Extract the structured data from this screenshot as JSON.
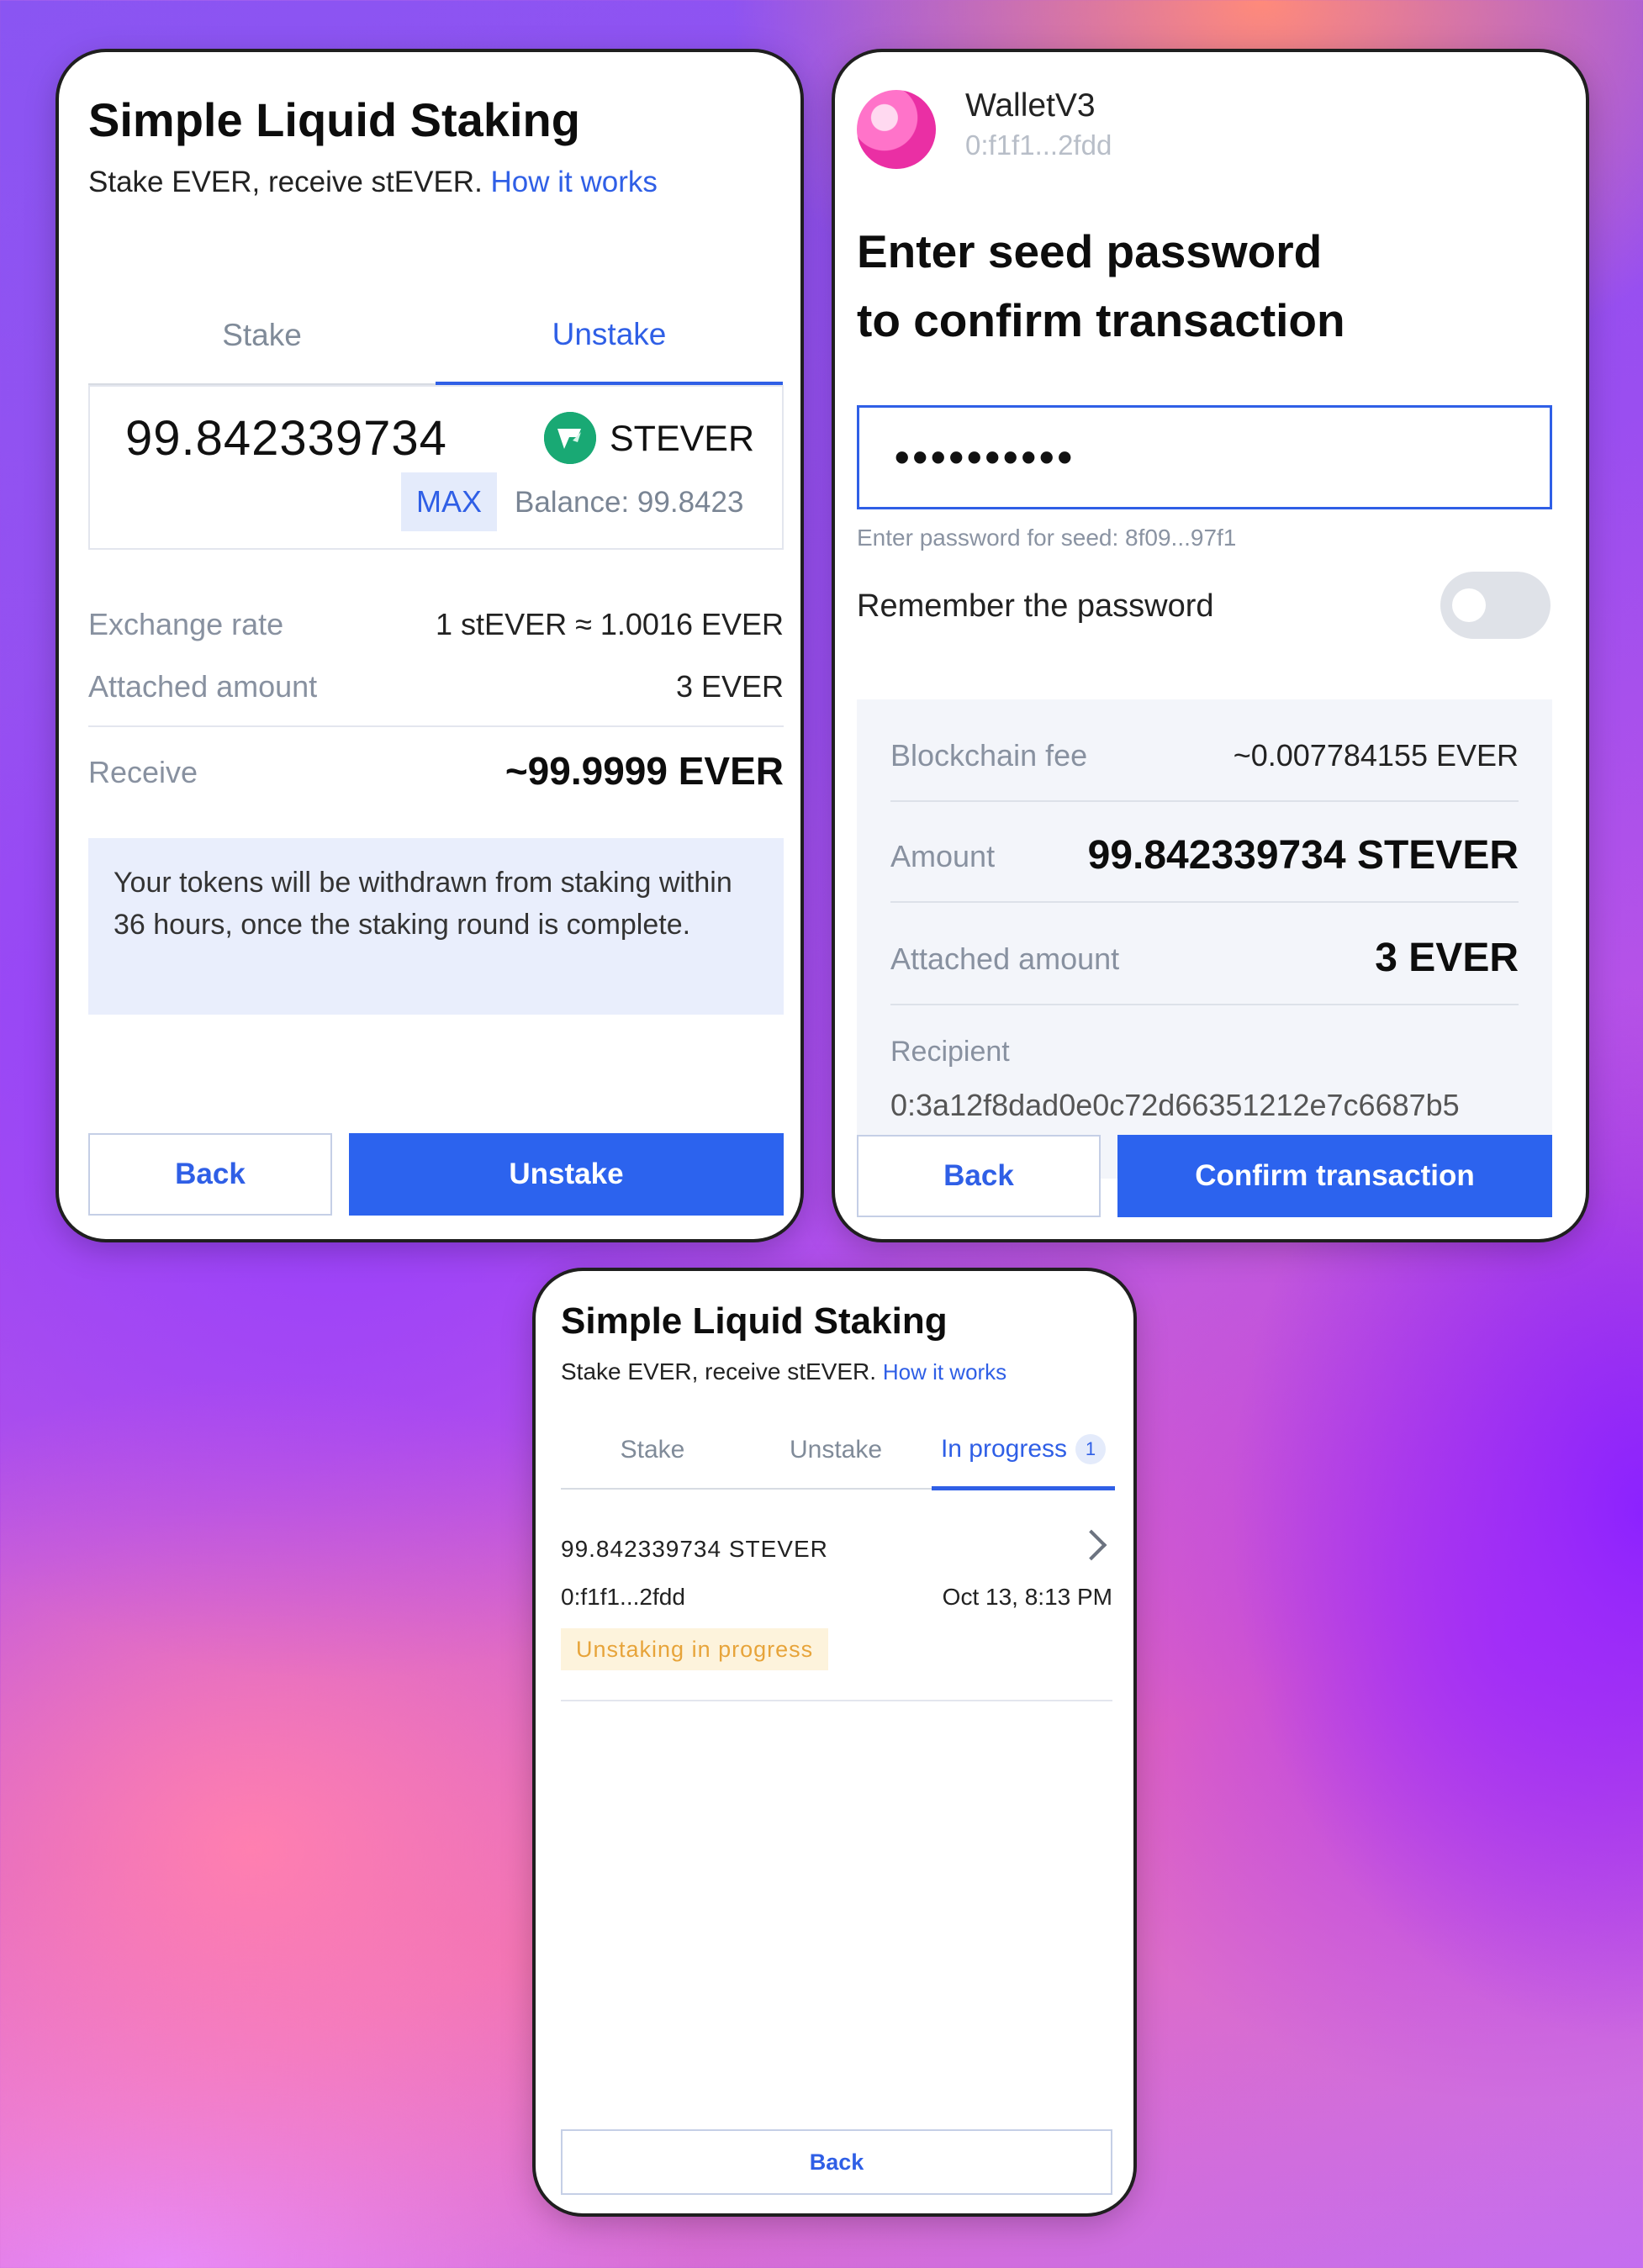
{
  "unstake_screen": {
    "title": "Simple Liquid Staking",
    "subtitle": "Stake EVER, receive stEVER.",
    "how_it_works": "How it works",
    "tabs": [
      "Stake",
      "Unstake"
    ],
    "active_tab": "Unstake",
    "amount": "99.842339734",
    "token": "STEVER",
    "max_label": "MAX",
    "balance": "Balance: 99.8423",
    "exchange_rate_label": "Exchange rate",
    "exchange_rate_value": "1 stEVER ≈ 1.0016 EVER",
    "attached_amount_label": "Attached amount",
    "attached_amount_value": "3 EVER",
    "receive_label": "Receive",
    "receive_value": "~99.9999 EVER",
    "notice": "Your tokens will be withdrawn from staking within 36 hours, once the staking round is complete.",
    "back_label": "Back",
    "submit_label": "Unstake"
  },
  "confirm_screen": {
    "wallet_name": "WalletV3",
    "wallet_address": "0:f1f1...2fdd",
    "heading_line1": "Enter seed password",
    "heading_line2": "to confirm transaction",
    "password_value": "••••••••••",
    "password_hint": "Enter password for seed: 8f09...97f1",
    "remember_label": "Remember the password",
    "remember_enabled": false,
    "blockchain_fee_label": "Blockchain fee",
    "blockchain_fee_value": "~0.007784155 EVER",
    "amount_label": "Amount",
    "amount_value": "99.842339734 STEVER",
    "attached_amount_label": "Attached amount",
    "attached_amount_value": "3 EVER",
    "recipient_label": "Recipient",
    "recipient_value": "0:3a12f8dad0e0c72d66351212e7c6687b5",
    "back_label": "Back",
    "confirm_label": "Confirm transaction"
  },
  "progress_screen": {
    "title": "Simple Liquid Staking",
    "subtitle": "Stake EVER, receive stEVER.",
    "how_it_works": "How it works",
    "tabs": [
      "Stake",
      "Unstake",
      "In progress"
    ],
    "active_tab": "In progress",
    "in_progress_count": "1",
    "item": {
      "amount": "99.842339734 STEVER",
      "address": "0:f1f1...2fdd",
      "date": "Oct 13, 8:13 PM",
      "status": "Unstaking in progress"
    },
    "back_label": "Back"
  },
  "colors": {
    "accent": "#2c63ee",
    "link": "#2f5fe6",
    "token_icon": "#19a974",
    "status_pending": "#e7a43a"
  },
  "icons": [
    "stever-token-icon",
    "wallet-avatar",
    "chevron-right-icon"
  ]
}
